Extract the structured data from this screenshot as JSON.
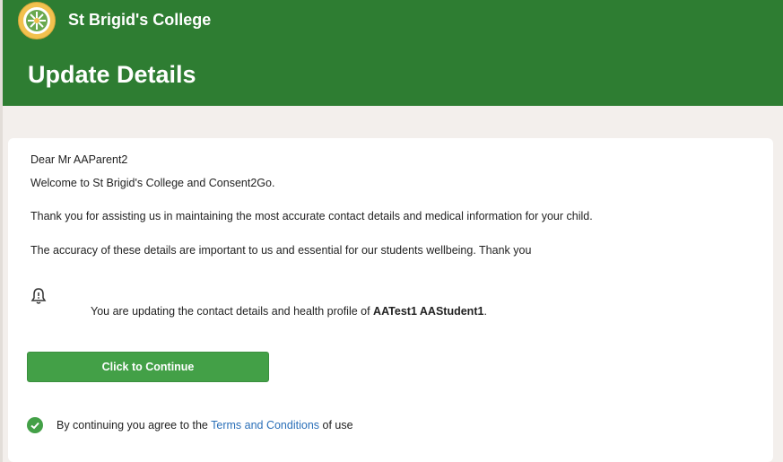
{
  "header": {
    "school_name": "St Brigid's College",
    "page_title": "Update Details",
    "logo_icon": "college-crest-icon",
    "colors": {
      "header_bg": "#2e7d32",
      "button_bg": "#43a047",
      "link": "#2a6fb8"
    }
  },
  "body": {
    "greeting": "Dear Mr AAParent2",
    "welcome": "Welcome to St Brigid's College and Consent2Go.",
    "thanks": "Thank you for assisting us in maintaining the most accurate contact details and medical information for your child.",
    "accuracy": "The accuracy of these details are important to us and essential for our students wellbeing. Thank you",
    "notice_icon": "bell-icon",
    "updating_prefix": "You are updating the contact details and health profile of ",
    "student_name": "AATest1 AAStudent1",
    "updating_suffix": ".",
    "continue_label": "Click to Continue",
    "agree_icon": "check-circle-icon",
    "agree_prefix": "By continuing you agree to the ",
    "terms_link": "Terms and Conditions",
    "agree_suffix": " of use"
  }
}
